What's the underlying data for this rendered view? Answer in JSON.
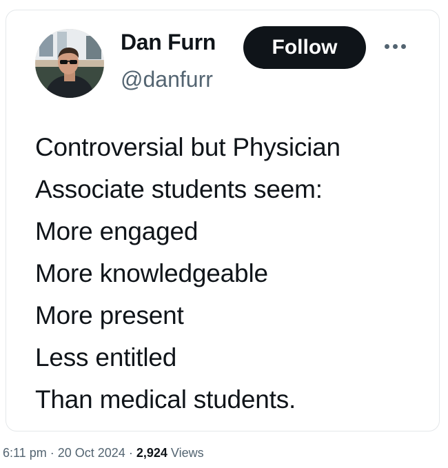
{
  "tweet": {
    "author": {
      "name": "Dan Furn",
      "handle": "@danfurr"
    },
    "follow_label": "Follow",
    "more_icon": "more-horizontal-icon",
    "lines": [
      "Controversial but Physician",
      "Associate students seem:",
      "More engaged",
      "More knowledgeable",
      "More present",
      "Less entitled",
      "Than medical students."
    ],
    "meta": {
      "time": "6:11 pm",
      "separator": "·",
      "date": "20 Oct 2024",
      "views_count": "2,924",
      "views_label": "Views"
    }
  },
  "colors": {
    "text": "#0f1419",
    "secondary": "#536471",
    "follow_bg": "#0f1419",
    "border": "#e4e7ea"
  }
}
